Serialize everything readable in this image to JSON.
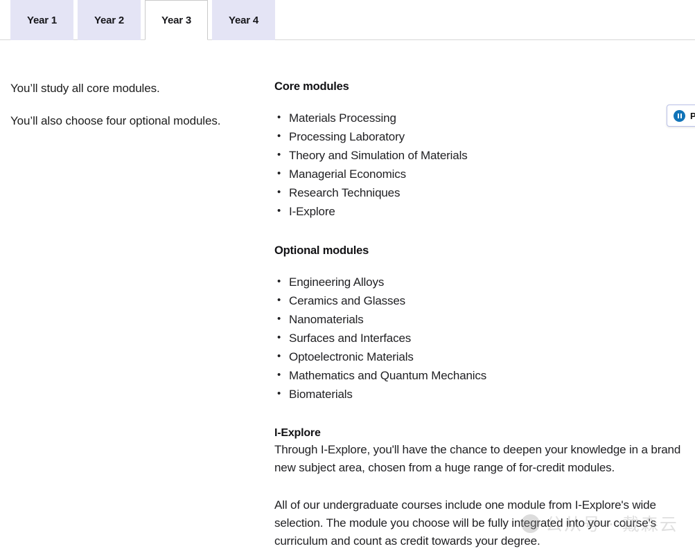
{
  "tabs": {
    "items": [
      {
        "label": "Year 1",
        "active": false
      },
      {
        "label": "Year 2",
        "active": false
      },
      {
        "label": "Year 3",
        "active": true
      },
      {
        "label": "Year 4",
        "active": false
      }
    ]
  },
  "left_column": {
    "paragraph_1": "You’ll study all core modules.",
    "paragraph_2": "You’ll also choose four optional modules."
  },
  "right_column": {
    "core_heading": "Core modules",
    "core_modules": [
      "Materials Processing",
      "Processing Laboratory",
      "Theory and Simulation of Materials",
      "Managerial Economics",
      "Research Techniques",
      "I-Explore"
    ],
    "optional_heading": "Optional modules",
    "optional_modules": [
      "Engineering Alloys",
      "Ceramics and Glasses",
      "Nanomaterials",
      "Surfaces and Interfaces",
      "Optoelectronic Materials",
      "Mathematics and Quantum Mechanics",
      "Biomaterials"
    ],
    "iexplore_heading": "I-Explore",
    "iexplore_paragraph_1": "Through I-Explore, you'll have the chance to deepen your knowledge in a brand new subject area, chosen from a huge range of for-credit modules.",
    "iexplore_paragraph_2": "All of our undergraduate courses include one module from I-Explore's wide selection. The module you choose will be fully integrated into your course's curriculum and count as credit towards your degree."
  },
  "pause_widget": {
    "label": "P",
    "icon": "pause-icon",
    "accent_color": "#1073b8"
  },
  "watermark": {
    "text": "公从号 · 戴森云",
    "logo": "wechat-logo"
  },
  "colors": {
    "tab_inactive_bg": "#e4e4f5",
    "tab_active_bg": "#ffffff",
    "tab_border": "#c9c9c9",
    "rule": "#d7d7d7",
    "text": "#1f1f22"
  }
}
